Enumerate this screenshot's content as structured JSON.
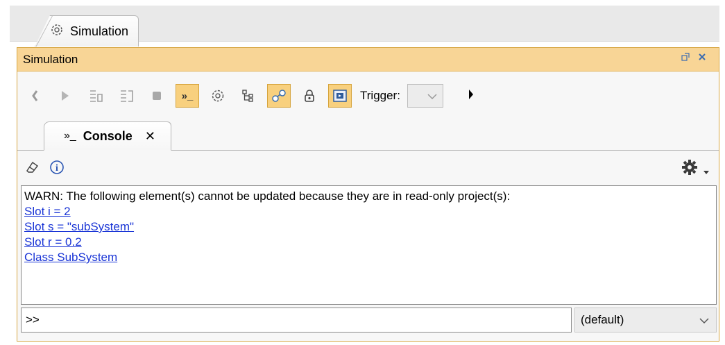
{
  "outer_tab": {
    "label": "Simulation",
    "icon": "simulation-gear-icon"
  },
  "panel": {
    "title": "Simulation",
    "icons": [
      "restore-icon",
      "close-icon"
    ]
  },
  "toolbar": {
    "buttons": [
      {
        "name": "step-back-button",
        "icon": "chevron-left-icon",
        "active": false
      },
      {
        "name": "run-button",
        "icon": "play-icon",
        "active": false
      },
      {
        "name": "step-into-button",
        "icon": "step-into-icon",
        "active": false
      },
      {
        "name": "step-over-button",
        "icon": "step-over-icon",
        "active": false
      },
      {
        "name": "stop-button",
        "icon": "stop-icon",
        "active": false
      },
      {
        "name": "console-toggle-button",
        "icon": "console-prompt-icon",
        "active": true
      },
      {
        "name": "sessions-button",
        "icon": "gear-outline-icon",
        "active": false
      },
      {
        "name": "variables-button",
        "icon": "tree-icon",
        "active": false
      },
      {
        "name": "breakpoints-button",
        "icon": "nodes-icon",
        "active": true
      },
      {
        "name": "lock-button",
        "icon": "lock-icon",
        "active": false
      },
      {
        "name": "animation-button",
        "icon": "animation-icon",
        "active": true
      }
    ],
    "trigger_label": "Trigger:",
    "trigger_value": ""
  },
  "console_tab": {
    "glyph": "»_",
    "label": "Console",
    "close": "✕"
  },
  "console_toolbar": {
    "icons": [
      "eraser-icon",
      "info-icon",
      "gear-icon",
      "dropdown-arrow-icon"
    ]
  },
  "output": {
    "warn": "WARN: The following element(s) cannot be updated because they are in read-only project(s):",
    "links": [
      "Slot i = 2",
      "Slot s = \"subSystem\"",
      "Slot r = 0.2",
      "Class SubSystem"
    ]
  },
  "input": {
    "value": ">>",
    "scope": "(default)"
  },
  "colors": {
    "panel_header": "#f8d596",
    "link": "#1a35d6",
    "active_button": "#f8d07e"
  }
}
